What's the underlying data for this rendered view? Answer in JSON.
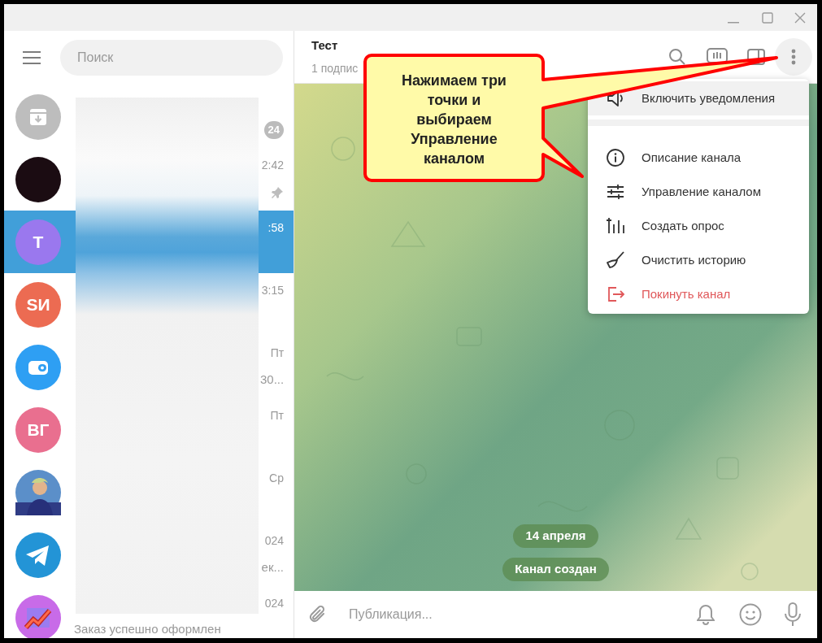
{
  "sidebar": {
    "search": {
      "placeholder": "Поиск"
    },
    "chats": [
      {
        "avatar": {
          "kind": "archive"
        },
        "badge": "24",
        "pinned": false,
        "selected": false
      },
      {
        "avatar": {
          "kind": "dark"
        },
        "time": "2:42",
        "pinned": true,
        "selected": false
      },
      {
        "avatar": {
          "kind": "letters",
          "text": "Т",
          "color": "#9a78ee"
        },
        "time": ":58",
        "pinned": false,
        "selected": true
      },
      {
        "avatar": {
          "kind": "letters",
          "text": "SИ",
          "color": "#ec6b52"
        },
        "time": "3:15",
        "pinned": false,
        "selected": false
      },
      {
        "avatar": {
          "kind": "wallet"
        },
        "time": "Пт",
        "pinned": false,
        "preview": "30...",
        "selected": false
      },
      {
        "avatar": {
          "kind": "letters",
          "text": "ВГ",
          "color": "#e96f8f"
        },
        "time": "Пт",
        "pinned": false,
        "selected": false
      },
      {
        "time": "Ср",
        "pinned": false,
        "selected": false
      },
      {
        "avatar": {
          "kind": "telegram"
        },
        "time": "024",
        "pinned": false,
        "preview": "ек...",
        "selected": false
      },
      {
        "avatar": {
          "kind": "chart"
        },
        "time": "024",
        "pinned": false,
        "preview": "Заказ успешно оформлен",
        "selected": false
      }
    ]
  },
  "chat": {
    "title": "Тест",
    "subtitle": "1 подпис",
    "service_messages": [
      "14 апреля",
      "Канал создан"
    ],
    "composer": {
      "placeholder": "Публикация..."
    }
  },
  "menu": [
    {
      "kind": "speaker",
      "label": "Включить уведомления",
      "highlighted": true,
      "danger": false
    },
    {
      "kind": "info",
      "label": "Описание канала",
      "highlighted": false,
      "danger": false
    },
    {
      "kind": "sliders",
      "label": "Управление каналом",
      "highlighted": false,
      "danger": false
    },
    {
      "kind": "poll",
      "label": "Создать опрос",
      "highlighted": false,
      "danger": false
    },
    {
      "kind": "broom",
      "label": "Очистить историю",
      "highlighted": false,
      "danger": false
    },
    {
      "kind": "leave",
      "label": "Покинуть канал",
      "highlighted": false,
      "danger": true
    }
  ],
  "callout": {
    "text": "Нажимаем три точки и выбираем Управление каналом"
  }
}
